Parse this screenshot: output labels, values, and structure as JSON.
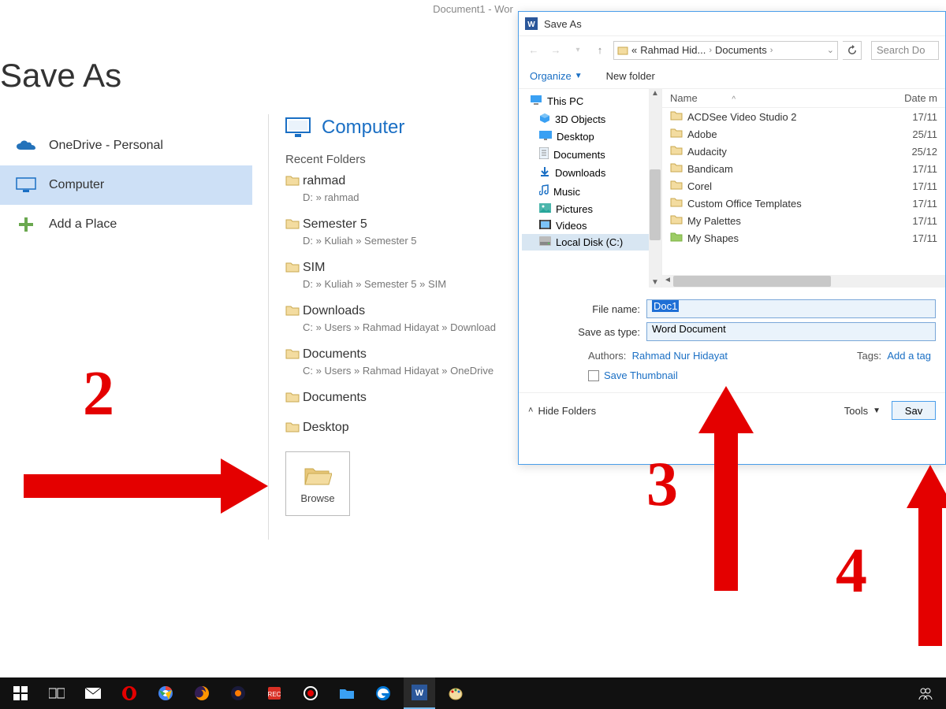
{
  "word_title": "Document1 - Wor",
  "page_title": "Save As",
  "locations": [
    {
      "id": "onedrive",
      "label": "OneDrive - Personal",
      "selected": false
    },
    {
      "id": "computer",
      "label": "Computer",
      "selected": true
    },
    {
      "id": "addplace",
      "label": "Add a Place",
      "selected": false
    }
  ],
  "right_panel": {
    "header": "Computer",
    "recent_label": "Recent Folders",
    "folders": [
      {
        "name": "rahmad",
        "path": "D: » rahmad"
      },
      {
        "name": "Semester 5",
        "path": "D: » Kuliah » Semester 5"
      },
      {
        "name": "SIM",
        "path": "D: » Kuliah » Semester 5 » SIM"
      },
      {
        "name": "Downloads",
        "path": "C: » Users » Rahmad Hidayat » Download"
      },
      {
        "name": "Documents",
        "path": "C: » Users » Rahmad Hidayat » OneDrive "
      },
      {
        "name": "Documents",
        "path": ""
      },
      {
        "name": "Desktop",
        "path": ""
      }
    ],
    "browse_label": "Browse"
  },
  "dialog": {
    "title": "Save As",
    "breadcrumb": {
      "prefix": "«",
      "part1": "Rahmad Hid...",
      "part2": "Documents"
    },
    "search_placeholder": "Search Do",
    "organize": "Organize",
    "new_folder": "New folder",
    "tree": [
      {
        "label": "This PC",
        "level": 1,
        "icon": "pc"
      },
      {
        "label": "3D Objects",
        "level": 2,
        "icon": "3d"
      },
      {
        "label": "Desktop",
        "level": 2,
        "icon": "desktop"
      },
      {
        "label": "Documents",
        "level": 2,
        "icon": "doc"
      },
      {
        "label": "Downloads",
        "level": 2,
        "icon": "dl"
      },
      {
        "label": "Music",
        "level": 2,
        "icon": "music"
      },
      {
        "label": "Pictures",
        "level": 2,
        "icon": "pic"
      },
      {
        "label": "Videos",
        "level": 2,
        "icon": "vid"
      },
      {
        "label": "Local Disk (C:)",
        "level": 2,
        "icon": "disk",
        "selected": true
      }
    ],
    "columns": {
      "name": "Name",
      "date": "Date m"
    },
    "files": [
      {
        "name": "ACDSee Video Studio 2",
        "date": "17/11"
      },
      {
        "name": "Adobe",
        "date": "25/11"
      },
      {
        "name": "Audacity",
        "date": "25/12"
      },
      {
        "name": "Bandicam",
        "date": "17/11"
      },
      {
        "name": "Corel",
        "date": "17/11"
      },
      {
        "name": "Custom Office Templates",
        "date": "17/11"
      },
      {
        "name": "My Palettes",
        "date": "17/11"
      },
      {
        "name": "My Shapes",
        "date": "17/11"
      }
    ],
    "filename_label": "File name:",
    "filename_value": "Doc1",
    "saveastype_label": "Save as type:",
    "saveastype_value": "Word Document",
    "authors_label": "Authors:",
    "authors_value": "Rahmad Nur Hidayat",
    "tags_label": "Tags:",
    "tags_value": "Add a tag",
    "save_thumbnail": "Save Thumbnail",
    "hide_folders": "Hide Folders",
    "tools": "Tools",
    "save": "Sav"
  },
  "annotations": {
    "two": "2",
    "three": "3",
    "four": "4"
  }
}
